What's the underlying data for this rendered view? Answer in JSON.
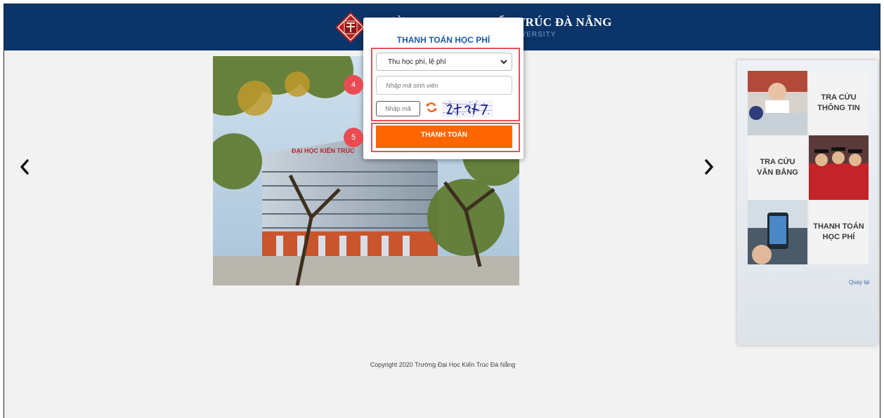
{
  "header": {
    "school_name": "TRƯỜNG ĐẠI HỌC KIẾN TRÚC ĐÀ NẴNG",
    "school_subtitle": "DA NANG ARCHITECTURE UNIVERSITY",
    "background_color": "#0b3569",
    "logo_icon": "university-logo-icon"
  },
  "carousel": {
    "prev_icon": "chevron-left-icon",
    "next_icon": "chevron-right-icon",
    "building_sign": "ĐẠI HỌC KIẾN TRÚC"
  },
  "payment_form": {
    "title": "THANH TOÁN HỌC PHÍ",
    "fee_type": {
      "selected": "Thu học phí, lệ phí"
    },
    "student_id": {
      "placeholder": "Nhập mã sinh viên",
      "value": ""
    },
    "captcha": {
      "placeholder": "Nhập mã",
      "value": "",
      "refresh_icon": "refresh-icon"
    },
    "submit_label": "THANH TOÁN",
    "accent_color": "#ff6600"
  },
  "annotations": {
    "step_4": "4",
    "step_5": "5",
    "highlight_color": "#e0545a"
  },
  "side_panel": {
    "tiles": [
      {
        "label": "TRA CỨU\nTHÔNG TIN"
      },
      {
        "label": "TRA CỨU\nVĂN BẰNG"
      },
      {
        "label": "THANH TOÁN\nHỌC PHÍ"
      }
    ],
    "back_link": "Quay lại"
  },
  "footer": {
    "copyright": "Copyright 2020 Trường Đại Học Kiến Trúc Đà Nẵng"
  }
}
